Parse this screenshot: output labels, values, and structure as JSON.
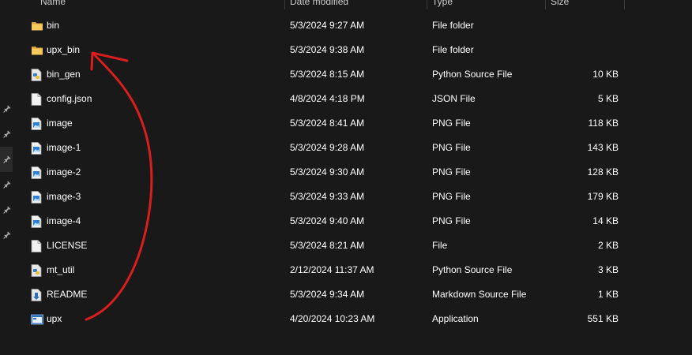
{
  "columns": {
    "name": "Name",
    "date": "Date modified",
    "type": "Type",
    "size": "Size"
  },
  "annotation_color": "#d81e1e",
  "files": [
    {
      "name": "bin",
      "date": "5/3/2024 9:27 AM",
      "type": "File folder",
      "size": "",
      "icon": "folder-icon"
    },
    {
      "name": "upx_bin",
      "date": "5/3/2024 9:38 AM",
      "type": "File folder",
      "size": "",
      "icon": "folder-icon"
    },
    {
      "name": "bin_gen",
      "date": "5/3/2024 8:15 AM",
      "type": "Python Source File",
      "size": "10 KB",
      "icon": "python-file-icon"
    },
    {
      "name": "config.json",
      "date": "4/8/2024 4:18 PM",
      "type": "JSON File",
      "size": "5 KB",
      "icon": "generic-file-icon"
    },
    {
      "name": "image",
      "date": "5/3/2024 8:41 AM",
      "type": "PNG File",
      "size": "118 KB",
      "icon": "image-file-icon"
    },
    {
      "name": "image-1",
      "date": "5/3/2024 9:28 AM",
      "type": "PNG File",
      "size": "143 KB",
      "icon": "image-file-icon"
    },
    {
      "name": "image-2",
      "date": "5/3/2024 9:30 AM",
      "type": "PNG File",
      "size": "128 KB",
      "icon": "image-file-icon"
    },
    {
      "name": "image-3",
      "date": "5/3/2024 9:33 AM",
      "type": "PNG File",
      "size": "179 KB",
      "icon": "image-file-icon"
    },
    {
      "name": "image-4",
      "date": "5/3/2024 9:40 AM",
      "type": "PNG File",
      "size": "14 KB",
      "icon": "image-file-icon"
    },
    {
      "name": "LICENSE",
      "date": "5/3/2024 8:21 AM",
      "type": "File",
      "size": "2 KB",
      "icon": "generic-file-icon"
    },
    {
      "name": "mt_util",
      "date": "2/12/2024 11:37 AM",
      "type": "Python Source File",
      "size": "3 KB",
      "icon": "python-file-icon"
    },
    {
      "name": "README",
      "date": "5/3/2024 9:34 AM",
      "type": "Markdown Source File",
      "size": "1 KB",
      "icon": "markdown-file-icon"
    },
    {
      "name": "upx",
      "date": "4/20/2024 10:23 AM",
      "type": "Application",
      "size": "551 KB",
      "icon": "application-icon"
    }
  ]
}
